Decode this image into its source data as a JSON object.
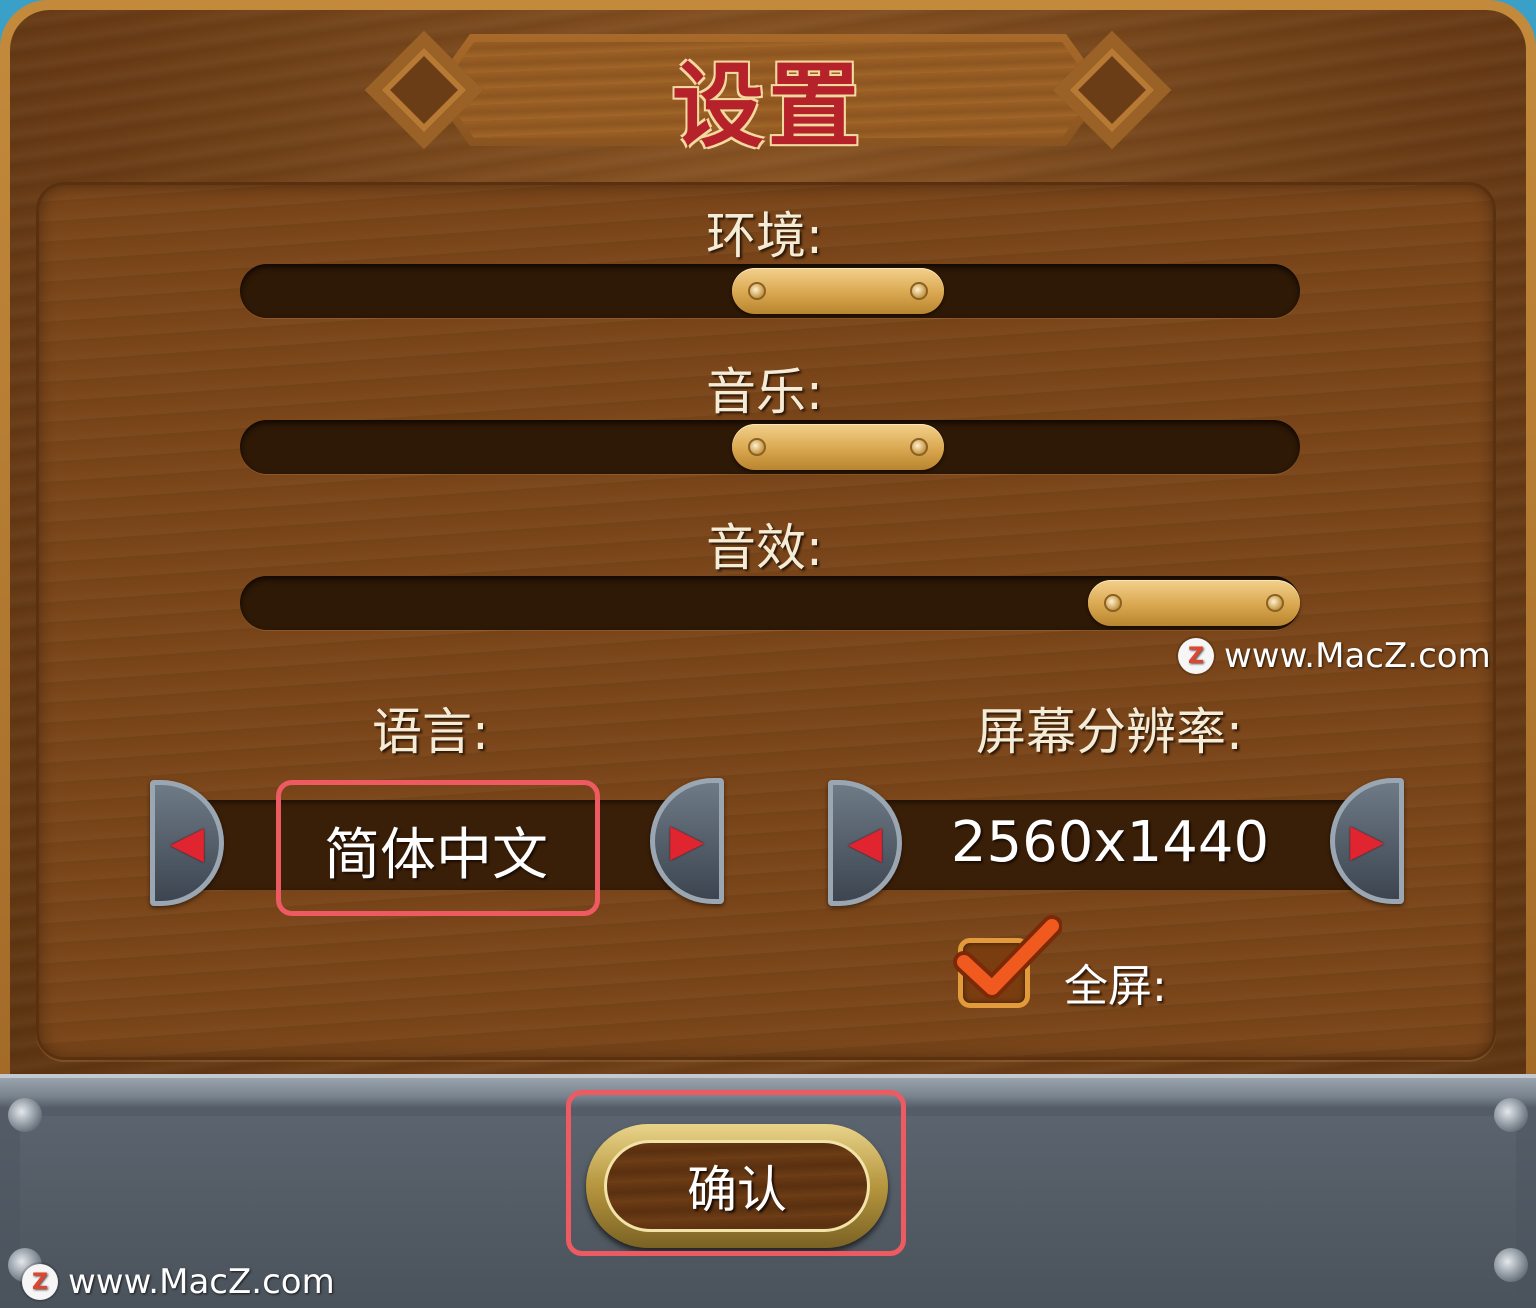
{
  "title": "设置",
  "sliders": [
    {
      "label": "环境:",
      "value": 0.58
    },
    {
      "label": "音乐:",
      "value": 0.58
    },
    {
      "label": "音效:",
      "value": 1.0
    }
  ],
  "language": {
    "label": "语言:",
    "value": "简体中文"
  },
  "resolution": {
    "label": "屏幕分辨率:",
    "value": "2560x1440"
  },
  "fullscreen": {
    "label": "全屏:",
    "checked": true
  },
  "confirm_label": "确认",
  "watermark": "www.MacZ.com",
  "watermark_logo": "Z",
  "icons": {
    "prev": "◀",
    "next": "▶"
  },
  "colors": {
    "highlight": "#ee5a62",
    "title": "#b5222a"
  }
}
